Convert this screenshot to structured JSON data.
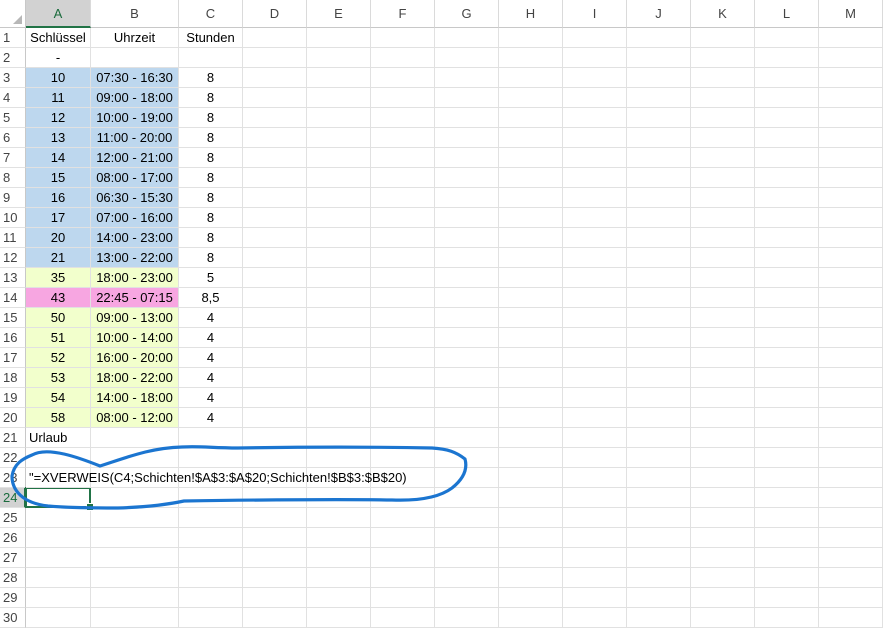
{
  "columns": [
    "A",
    "B",
    "C",
    "D",
    "E",
    "F",
    "G",
    "H",
    "I",
    "J",
    "K",
    "L",
    "M"
  ],
  "rows": [
    1,
    2,
    3,
    4,
    5,
    6,
    7,
    8,
    9,
    10,
    11,
    12,
    13,
    14,
    15,
    16,
    17,
    18,
    19,
    20,
    21,
    22,
    23,
    24,
    25,
    26,
    27,
    28,
    29,
    30
  ],
  "selected_cell": "A24",
  "colors": {
    "blue_fill": "#bdd7ee",
    "yellow_fill": "#f2ffcc",
    "pink_fill": "#f7a6e1",
    "selection": "#217346",
    "annotation": "#1b75d0"
  },
  "header_row": {
    "key": "Schlüssel",
    "time": "Uhrzeit",
    "hours": "Stunden"
  },
  "row2": {
    "key": "-"
  },
  "shifts": [
    {
      "row": 3,
      "key": "10",
      "time": "07:30 - 16:30",
      "hours": "8",
      "fill": "blue"
    },
    {
      "row": 4,
      "key": "11",
      "time": "09:00 - 18:00",
      "hours": "8",
      "fill": "blue"
    },
    {
      "row": 5,
      "key": "12",
      "time": "10:00 - 19:00",
      "hours": "8",
      "fill": "blue"
    },
    {
      "row": 6,
      "key": "13",
      "time": "11:00 - 20:00",
      "hours": "8",
      "fill": "blue"
    },
    {
      "row": 7,
      "key": "14",
      "time": "12:00 - 21:00",
      "hours": "8",
      "fill": "blue"
    },
    {
      "row": 8,
      "key": "15",
      "time": "08:00 - 17:00",
      "hours": "8",
      "fill": "blue"
    },
    {
      "row": 9,
      "key": "16",
      "time": "06:30 - 15:30",
      "hours": "8",
      "fill": "blue"
    },
    {
      "row": 10,
      "key": "17",
      "time": "07:00 - 16:00",
      "hours": "8",
      "fill": "blue"
    },
    {
      "row": 11,
      "key": "20",
      "time": "14:00 - 23:00",
      "hours": "8",
      "fill": "blue"
    },
    {
      "row": 12,
      "key": "21",
      "time": "13:00 - 22:00",
      "hours": "8",
      "fill": "blue"
    },
    {
      "row": 13,
      "key": "35",
      "time": "18:00 - 23:00",
      "hours": "5",
      "fill": "yellow"
    },
    {
      "row": 14,
      "key": "43",
      "time": "22:45 - 07:15",
      "hours": "8,5",
      "fill": "pink"
    },
    {
      "row": 15,
      "key": "50",
      "time": "09:00 - 13:00",
      "hours": "4",
      "fill": "yellow"
    },
    {
      "row": 16,
      "key": "51",
      "time": "10:00 - 14:00",
      "hours": "4",
      "fill": "yellow"
    },
    {
      "row": 17,
      "key": "52",
      "time": "16:00 - 20:00",
      "hours": "4",
      "fill": "yellow"
    },
    {
      "row": 18,
      "key": "53",
      "time": "18:00 - 22:00",
      "hours": "4",
      "fill": "yellow"
    },
    {
      "row": 19,
      "key": "54",
      "time": "14:00 - 18:00",
      "hours": "4",
      "fill": "yellow"
    },
    {
      "row": 20,
      "key": "58",
      "time": "08:00 - 12:00",
      "hours": "4",
      "fill": "yellow"
    }
  ],
  "row21": {
    "label": "Urlaub"
  },
  "row23": {
    "formula_text": "\"=XVERWEIS(C4;Schichten!$A$3:$A$20;Schichten!$B$3:$B$20)"
  }
}
